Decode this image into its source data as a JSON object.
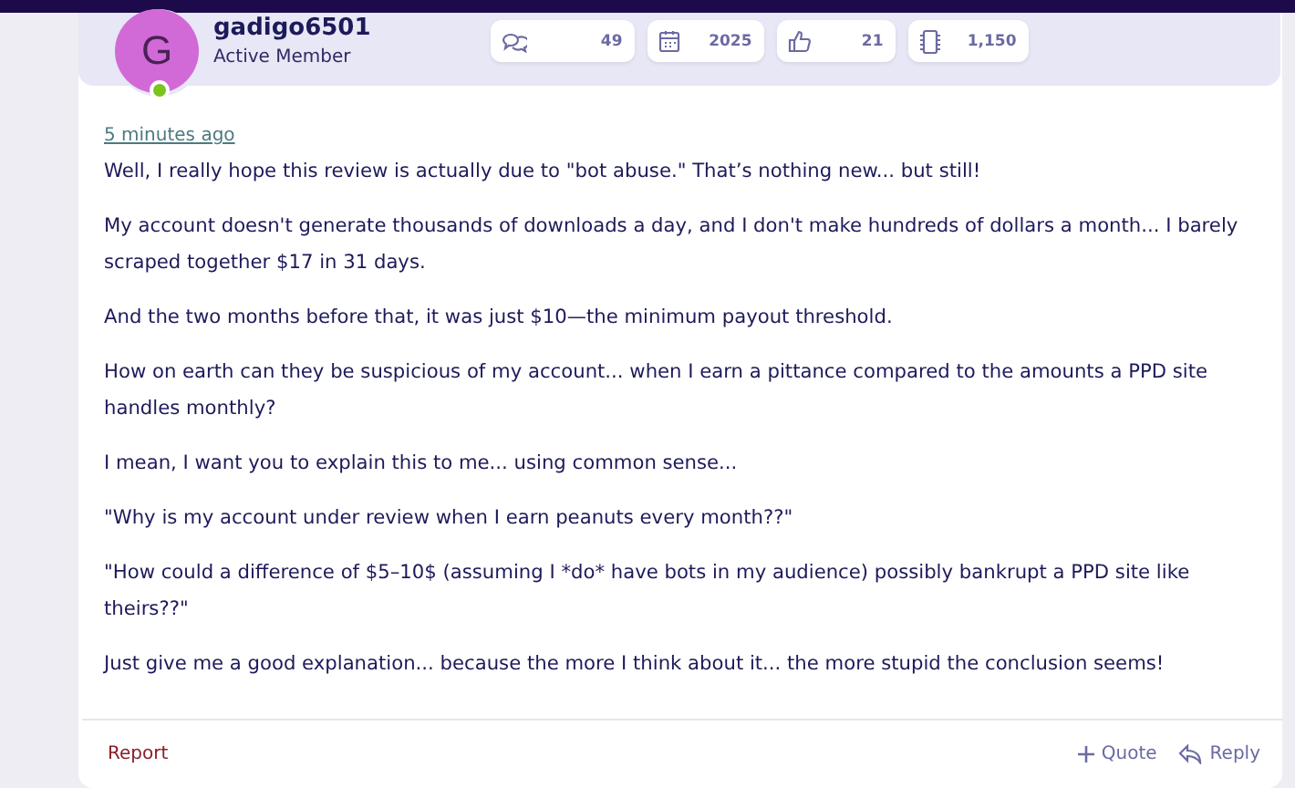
{
  "author": {
    "initial": "G",
    "name": "gadigo6501",
    "title": "Active Member",
    "online": true
  },
  "stats": [
    {
      "kind": "messages",
      "value": "49"
    },
    {
      "kind": "joined",
      "value": "2025"
    },
    {
      "kind": "reactions",
      "value": "21"
    },
    {
      "kind": "points",
      "value": "1,150"
    }
  ],
  "post": {
    "time": "5 minutes ago",
    "paragraphs": [
      "Well, I really hope this review is actually due to \"bot abuse.\" That’s nothing new... but still!",
      "My account doesn't generate thousands of downloads a day, and I don't make hundreds of dollars a month... I barely scraped together $17 in 31 days.",
      "And the two months before that, it was just $10—the minimum payout threshold.",
      "How on earth can they be suspicious of my account... when I earn a pittance compared to the amounts a PPD site handles monthly?",
      "I mean, I want you to explain this to me... using common sense...",
      "\"Why is my account under review when I earn peanuts every month??\"",
      "\"How could a difference of $5–10$ (assuming I *do* have bots in my audience) possibly bankrupt a PPD site like theirs??\"",
      "Just give me a good explanation... because the more I think about it... the more stupid the conclusion seems!"
    ]
  },
  "footer": {
    "report": "Report",
    "quote": "Quote",
    "reply": "Reply"
  }
}
